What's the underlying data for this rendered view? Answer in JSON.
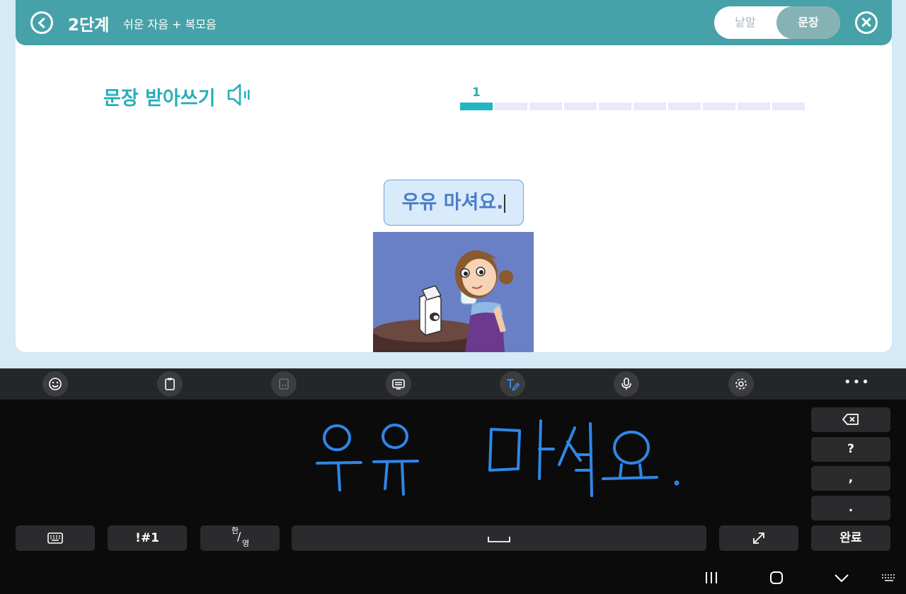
{
  "header": {
    "level_title": "2단계",
    "level_subtitle": "쉬운 자음 + 복모음",
    "mode_word": "낱말",
    "mode_sentence": "문장",
    "mode_selected": "문장"
  },
  "exercise": {
    "title": "문장 받아쓰기",
    "progress_label": "1",
    "progress_current": 1,
    "progress_total": 10,
    "answer_text": "우유 마셔요."
  },
  "keyboard": {
    "handwriting_text": "우유 마셔요.",
    "symbols_label": "!#1",
    "lang_label_top": "한",
    "lang_label_bottom": "영",
    "question_key": "?",
    "comma_key": ",",
    "period_key": ".",
    "done_label": "완료"
  },
  "colors": {
    "header_bg": "#46a2a8",
    "accent": "#27aeb9",
    "answer_text": "#4a7ec7",
    "handwriting_ink": "#2f86e6"
  }
}
